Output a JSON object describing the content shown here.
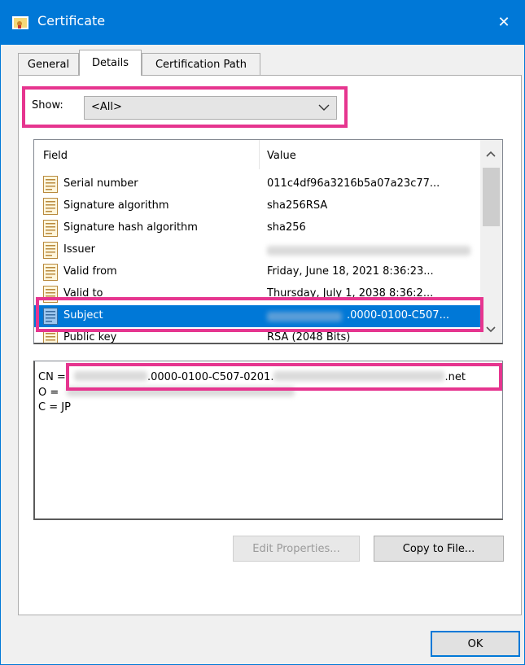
{
  "window": {
    "title": "Certificate",
    "close_glyph": "✕"
  },
  "tabs": [
    {
      "label": "General",
      "active": false
    },
    {
      "label": "Details",
      "active": true
    },
    {
      "label": "Certification Path",
      "active": false
    }
  ],
  "show": {
    "label": "Show:",
    "selected": "<All>"
  },
  "list": {
    "columns": {
      "field": "Field",
      "value": "Value"
    },
    "rows": [
      {
        "field": "Serial number",
        "value": "011c4df96a3216b5a07a23c77..."
      },
      {
        "field": "Signature algorithm",
        "value": "sha256RSA"
      },
      {
        "field": "Signature hash algorithm",
        "value": "sha256"
      },
      {
        "field": "Issuer",
        "value": ""
      },
      {
        "field": "Valid from",
        "value": "Friday, June 18, 2021 8:36:23..."
      },
      {
        "field": "Valid to",
        "value": "Thursday, July 1, 2038 8:36:2..."
      },
      {
        "field": "Subject",
        "value": ".0000-0100-C507...",
        "selected": true
      },
      {
        "field": "Public key",
        "value": "RSA (2048 Bits)"
      }
    ]
  },
  "detail": {
    "line_cn_prefix": "CN =",
    "line_cn_middle": ".0000-0100-C507-0201.",
    "line_cn_suffix": ".net",
    "line_o": "O =",
    "line_c": "C = JP"
  },
  "buttons": {
    "edit_properties": "Edit Properties...",
    "copy_to_file": "Copy to File...",
    "ok": "OK"
  },
  "colors": {
    "titlebar": "#0078d7",
    "highlight": "#e6358f",
    "selection": "#0078d7"
  },
  "icons": [
    "certificate-icon",
    "close-icon",
    "chevron-down-icon",
    "scroll-up-icon",
    "scroll-down-icon"
  ]
}
